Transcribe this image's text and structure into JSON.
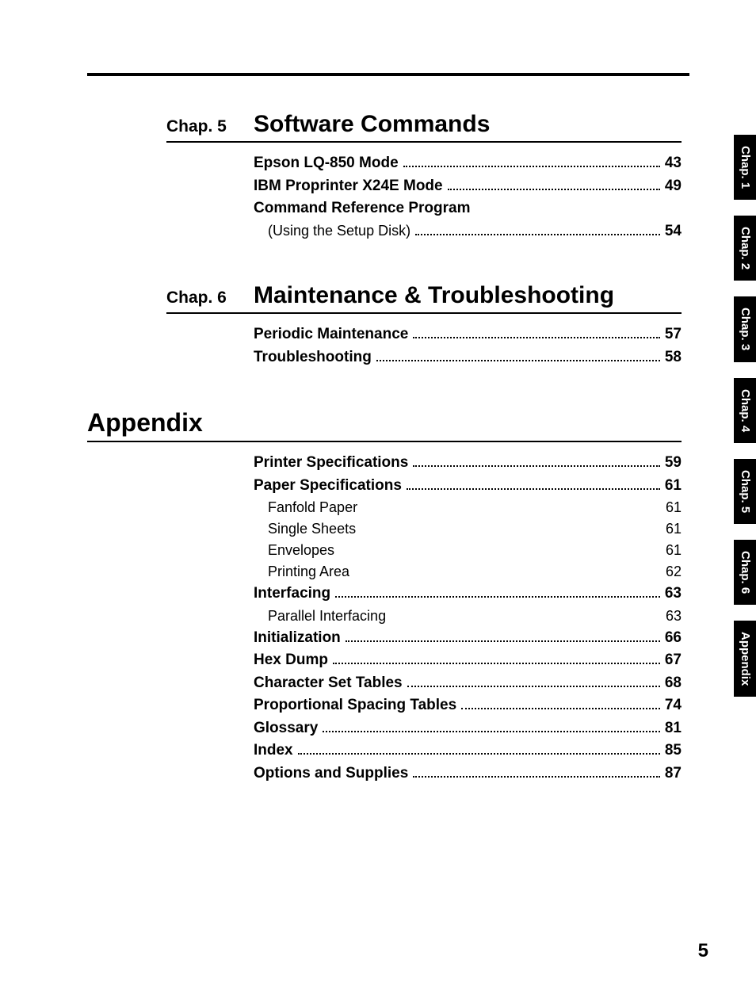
{
  "sections": [
    {
      "chap_label": "Chap. 5",
      "title": "Software Commands",
      "entries": [
        {
          "label": "Epson LQ-850 Mode",
          "page": "43",
          "type": "main"
        },
        {
          "label": "IBM Proprinter X24E Mode",
          "page": "49",
          "type": "main"
        },
        {
          "label": "Command Reference Program",
          "page": "",
          "type": "nohead"
        },
        {
          "label": "(Using the Setup Disk)",
          "page": "54",
          "type": "paren"
        }
      ]
    },
    {
      "chap_label": "Chap. 6",
      "title": "Maintenance & Troubleshooting",
      "entries": [
        {
          "label": "Periodic Maintenance",
          "page": "57",
          "type": "main"
        },
        {
          "label": "Troubleshooting",
          "page": "58",
          "type": "main"
        }
      ]
    },
    {
      "chap_label": "",
      "title": "Appendix",
      "appendix": true,
      "entries": [
        {
          "label": "Printer Specifications",
          "page": "59",
          "type": "main"
        },
        {
          "label": "Paper Specifications",
          "page": "61",
          "type": "main"
        },
        {
          "label": "Fanfold Paper",
          "page": "61",
          "type": "sub"
        },
        {
          "label": "Single Sheets",
          "page": "61",
          "type": "sub"
        },
        {
          "label": "Envelopes",
          "page": "61",
          "type": "sub"
        },
        {
          "label": "Printing Area",
          "page": "62",
          "type": "sub"
        },
        {
          "label": "Interfacing",
          "page": "63",
          "type": "main"
        },
        {
          "label": "Parallel Interfacing",
          "page": "63",
          "type": "sub"
        },
        {
          "label": "Initialization",
          "page": "66",
          "type": "main"
        },
        {
          "label": "Hex Dump",
          "page": "67",
          "type": "main"
        },
        {
          "label": "Character Set Tables",
          "page": "68",
          "type": "main"
        },
        {
          "label": "Proportional Spacing Tables",
          "page": "74",
          "type": "main"
        },
        {
          "label": "Glossary",
          "page": "81",
          "type": "main"
        },
        {
          "label": "Index",
          "page": "85",
          "type": "main"
        },
        {
          "label": "Options and Supplies",
          "page": "87",
          "type": "main"
        }
      ]
    }
  ],
  "tabs": [
    "Chap. 1",
    "Chap. 2",
    "Chap. 3",
    "Chap. 4",
    "Chap. 5",
    "Chap. 6",
    "Appendix"
  ],
  "page_number": "5"
}
